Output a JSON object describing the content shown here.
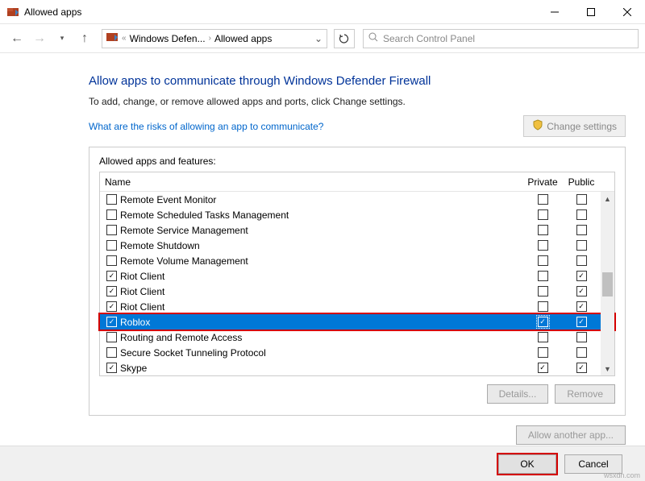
{
  "window": {
    "title": "Allowed apps"
  },
  "breadcrumb": {
    "seg1": "Windows Defen...",
    "seg2": "Allowed apps"
  },
  "search": {
    "placeholder": "Search Control Panel"
  },
  "heading": "Allow apps to communicate through Windows Defender Firewall",
  "subtitle": "To add, change, or remove allowed apps and ports, click Change settings.",
  "risk_link": "What are the risks of allowing an app to communicate?",
  "change_settings": "Change settings",
  "group_label": "Allowed apps and features:",
  "cols": {
    "name": "Name",
    "private": "Private",
    "public": "Public"
  },
  "rows": [
    {
      "name": "Remote Event Monitor",
      "on": false,
      "pri": false,
      "pub": false
    },
    {
      "name": "Remote Scheduled Tasks Management",
      "on": false,
      "pri": false,
      "pub": false
    },
    {
      "name": "Remote Service Management",
      "on": false,
      "pri": false,
      "pub": false
    },
    {
      "name": "Remote Shutdown",
      "on": false,
      "pri": false,
      "pub": false
    },
    {
      "name": "Remote Volume Management",
      "on": false,
      "pri": false,
      "pub": false
    },
    {
      "name": "Riot Client",
      "on": true,
      "pri": false,
      "pub": true
    },
    {
      "name": "Riot Client",
      "on": true,
      "pri": false,
      "pub": true
    },
    {
      "name": "Riot Client",
      "on": true,
      "pri": false,
      "pub": true
    },
    {
      "name": "Roblox",
      "on": true,
      "pri": true,
      "pub": true,
      "selected": true
    },
    {
      "name": "Routing and Remote Access",
      "on": false,
      "pri": false,
      "pub": false
    },
    {
      "name": "Secure Socket Tunneling Protocol",
      "on": false,
      "pri": false,
      "pub": false
    },
    {
      "name": "Skype",
      "on": true,
      "pri": true,
      "pub": true
    }
  ],
  "buttons": {
    "details": "Details...",
    "remove": "Remove",
    "allow_another": "Allow another app...",
    "ok": "OK",
    "cancel": "Cancel"
  },
  "watermark": "wsxdn.com"
}
